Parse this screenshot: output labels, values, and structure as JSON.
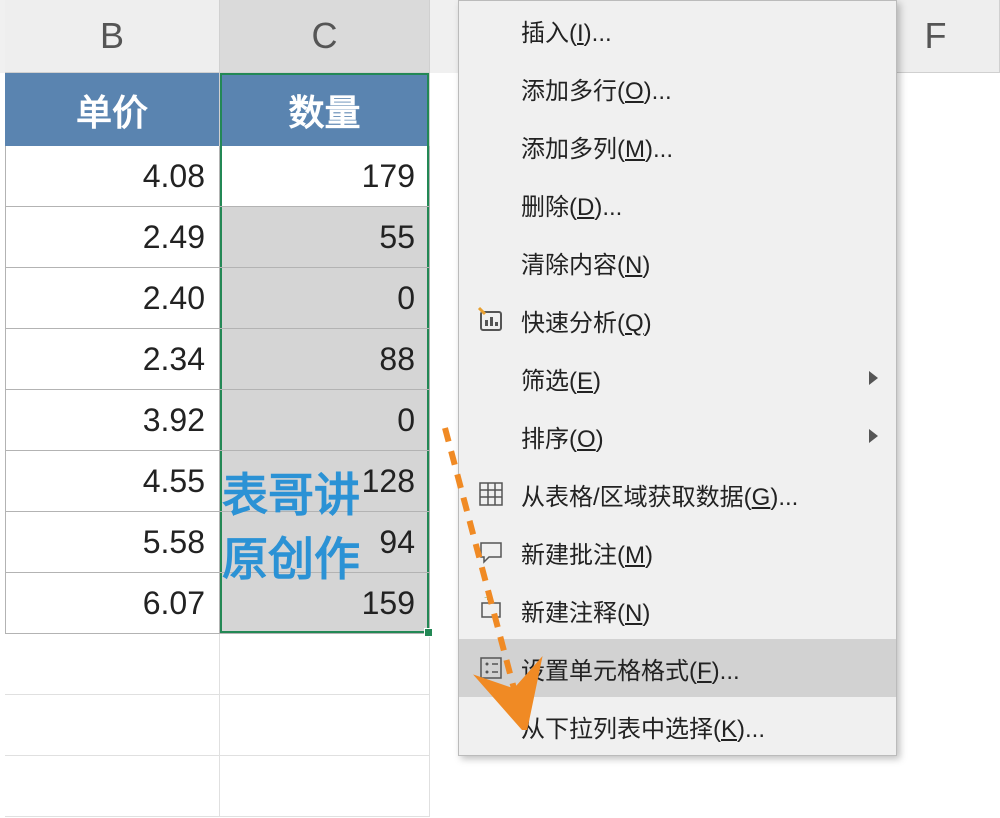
{
  "columns": {
    "b": "B",
    "c": "C",
    "f": "F"
  },
  "headers": {
    "b": "单价",
    "c": "数量"
  },
  "rows": [
    {
      "b": "4.08",
      "c": "179"
    },
    {
      "b": "2.49",
      "c": "55"
    },
    {
      "b": "2.40",
      "c": "0"
    },
    {
      "b": "2.34",
      "c": "88"
    },
    {
      "b": "3.92",
      "c": "0"
    },
    {
      "b": "4.55",
      "c": "128"
    },
    {
      "b": "5.58",
      "c": "94"
    },
    {
      "b": "6.07",
      "c": "159"
    }
  ],
  "menu": {
    "insert": "插入(<u>I</u>)...",
    "addRows": "添加多行(<u>O</u>)...",
    "addCols": "添加多列(<u>M</u>)...",
    "delete": "删除(<u>D</u>)...",
    "clear": "清除内容(<u>N</u>)",
    "quickAnalysis": "快速分析(<u>Q</u>)",
    "filter": "筛选(<u>E</u>)",
    "sort": "排序(<u>O</u>)",
    "getData": "从表格/区域获取数据(<u>G</u>)...",
    "newComment": "新建批注(<u>M</u>)",
    "newNote": "新建注释(<u>N</u>)",
    "formatCells": "设置单元格格式(<u>F</u>)...",
    "pickList": "从下拉列表中选择(<u>K</u>)..."
  },
  "watermark": {
    "line1": "表哥讲",
    "line2": "原创作"
  }
}
